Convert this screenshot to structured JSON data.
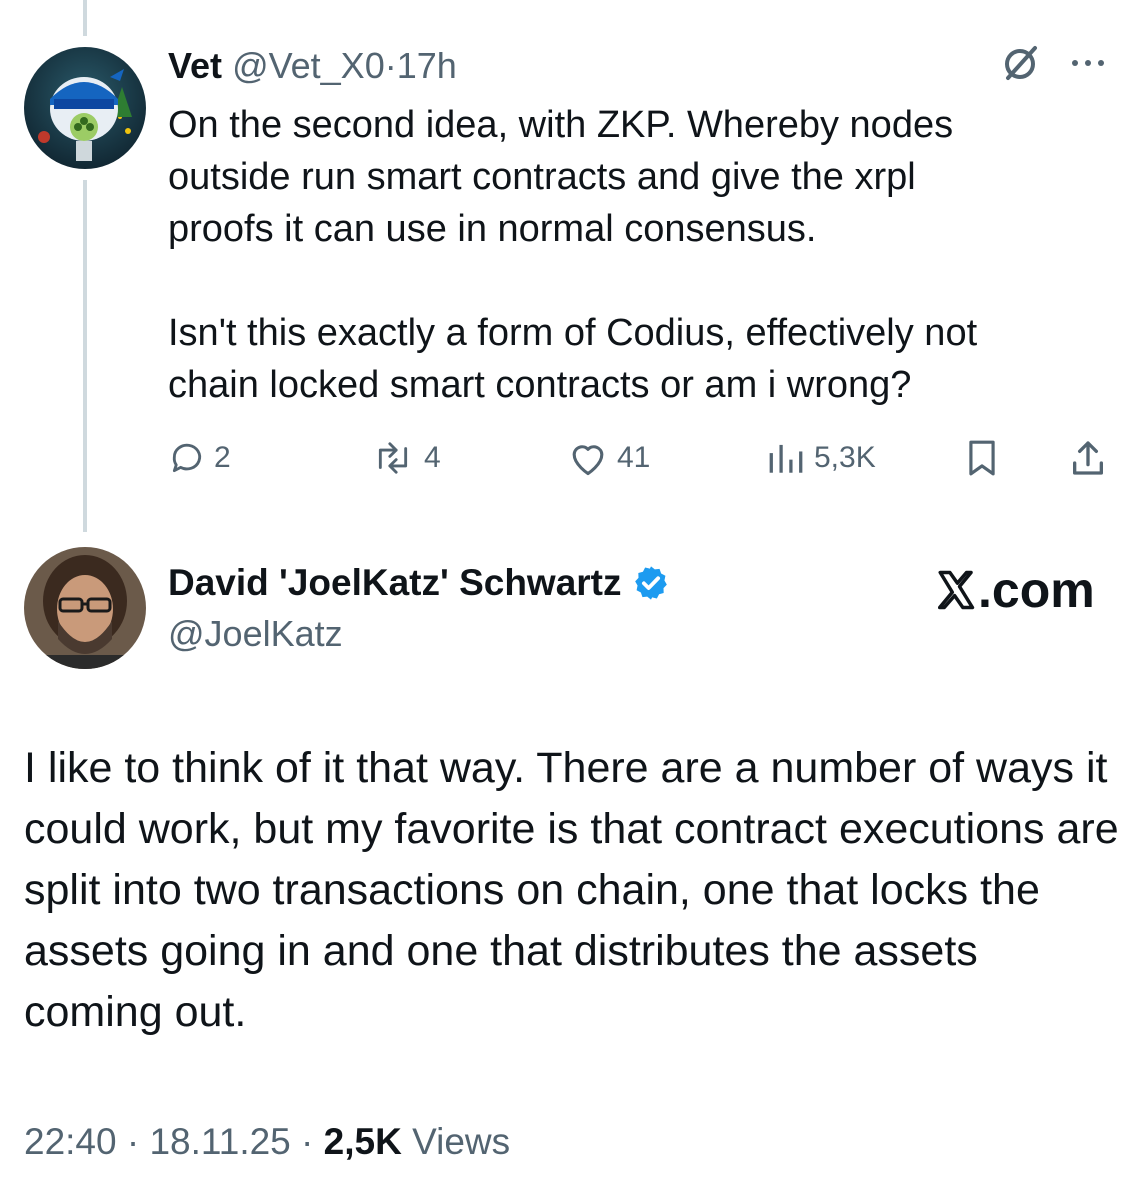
{
  "reply_tweet": {
    "display_name": "Vet",
    "handle": "@Vet_X0",
    "separator": "·",
    "time": "17h",
    "text": "On the second idea, with ZKP. Whereby nodes\noutside run smart contracts and give the xrpl\nproofs it can use in normal consensus.\n\nIsn't this exactly a form of Codius, effectively not\nchain locked smart contracts or am i wrong?",
    "icons": {
      "grok": "grok-icon",
      "more": "more-icon"
    },
    "actions": {
      "replies": "2",
      "reposts": "4",
      "likes": "41",
      "views": "5,3K"
    }
  },
  "main_tweet": {
    "display_name": "David 'JoelKatz' Schwartz",
    "handle": "@JoelKatz",
    "verified": true,
    "brand": ".com",
    "text": "I like to think of it that way. There are a number of ways it could work, but my favorite is that contract executions are split into two transactions on chain, one that locks the assets going in and one that distributes the assets coming out.",
    "time": "22:40",
    "separator": "·",
    "date": "18.11.25",
    "views_count": "2,5K",
    "views_label": "Views"
  },
  "colors": {
    "text": "#0f1419",
    "muted": "#536471",
    "thread_line": "#cfd9de",
    "verified": "#1d9bf0"
  }
}
